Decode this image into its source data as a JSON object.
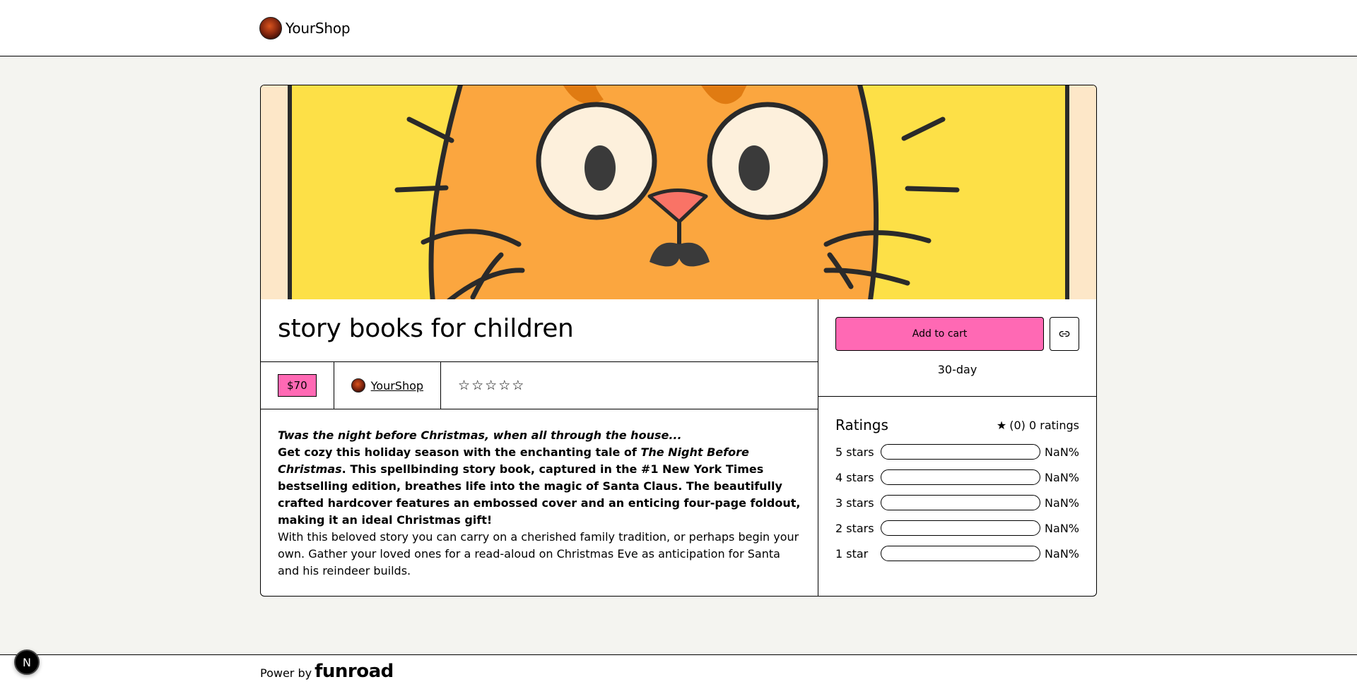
{
  "header": {
    "brand_name": "YourShop",
    "brand_logo_icon": "shop-avatar"
  },
  "product": {
    "title": "story books for children",
    "price": "$70",
    "seller": "YourShop",
    "rating_stars_filled": 0,
    "rating_stars_total": 5,
    "description": {
      "intro_italic": "Twas the night before Christmas, when all through the house...",
      "bold_part1": "Get cozy this holiday season with the enchanting tale of ",
      "bold_book_title": "The Night Before Christmas",
      "bold_part2": ". This spellbinding story book, captured in the #1 New York Times bestselling edition, breathes life into the magic of Santa Claus. The beautifully crafted hardcover features an embossed cover and an enticing four-page foldout, making it an ideal Christmas gift!",
      "plain": "With this beloved story you can carry on a cherished family tradition, or perhaps begin your own. Gather your loved ones for a read-aloud on Christmas Eve as anticipation for Santa and his reindeer builds."
    }
  },
  "purchase": {
    "add_to_cart_label": "Add to cart",
    "copy_link_icon": "link-icon",
    "refund_policy": "30-day"
  },
  "ratings": {
    "title": "Ratings",
    "summary": "(0) 0 ratings",
    "rows": [
      {
        "label": "5 stars",
        "percent": "NaN%",
        "fill": 0
      },
      {
        "label": "4 stars",
        "percent": "NaN%",
        "fill": 0
      },
      {
        "label": "3 stars",
        "percent": "NaN%",
        "fill": 0
      },
      {
        "label": "2 stars",
        "percent": "NaN%",
        "fill": 0
      },
      {
        "label": "1 star",
        "percent": "NaN%",
        "fill": 0
      }
    ]
  },
  "footer": {
    "power_by": "Power by",
    "brand": "funroad"
  },
  "dev_badge": "N",
  "colors": {
    "accent_pink": "#ff69b4",
    "background": "#f4f4f0"
  }
}
